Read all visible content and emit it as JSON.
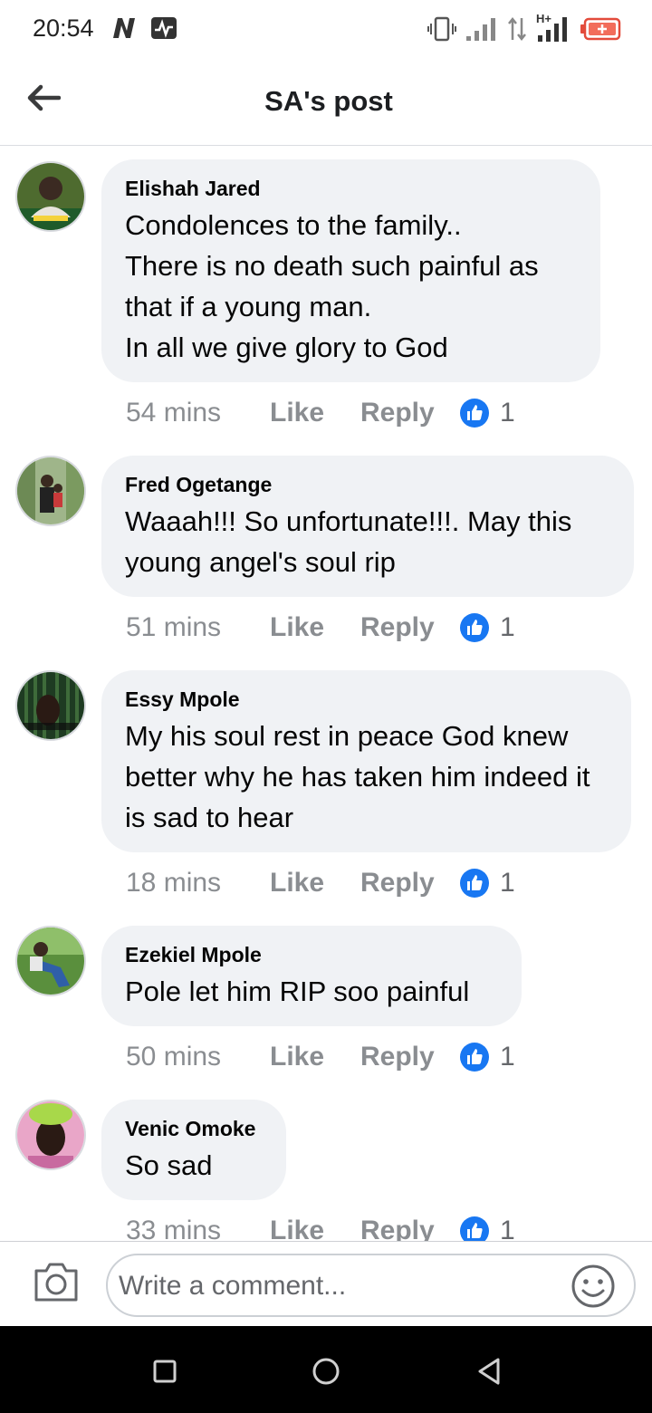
{
  "status_bar": {
    "time": "20:54",
    "icons": [
      "n-icon",
      "activity-icon",
      "vibrate-icon",
      "signal-icon",
      "data-arrows-icon",
      "hplus-signal-icon",
      "battery-icon"
    ],
    "network_label": "H+"
  },
  "header": {
    "title": "SA's post",
    "back_icon": "arrow-left-icon"
  },
  "comments": [
    {
      "author": "Elishah Jared",
      "text": "Condolences to the family..\nThere is no death such painful as that if a young man.\nIn all we give glory to God",
      "time": "54 mins",
      "like_label": "Like",
      "reply_label": "Reply",
      "reactions": "1"
    },
    {
      "author": "Fred Ogetange",
      "text": "Waaah!!! So unfortunate!!!. May this young angel's soul rip",
      "time": "51 mins",
      "like_label": "Like",
      "reply_label": "Reply",
      "reactions": "1"
    },
    {
      "author": "Essy Mpole",
      "text": "My his soul rest in peace God knew better why he has taken him indeed it is sad to hear",
      "time": "18 mins",
      "like_label": "Like",
      "reply_label": "Reply",
      "reactions": "1"
    },
    {
      "author": "Ezekiel Mpole",
      "text": "Pole let him RIP soo painful",
      "time": "50 mins",
      "like_label": "Like",
      "reply_label": "Reply",
      "reactions": "1"
    },
    {
      "author": "Venic Omoke",
      "text": "So sad",
      "time": "33 mins",
      "like_label": "Like",
      "reply_label": "Reply",
      "reactions": "1"
    }
  ],
  "composer": {
    "placeholder": "Write a comment...",
    "camera_icon": "camera-icon",
    "emoji_icon": "smiley-icon"
  },
  "navbar": {
    "icons": [
      "square-icon",
      "circle-icon",
      "triangle-back-icon"
    ]
  },
  "colors": {
    "like_blue": "#1877f2",
    "bubble_bg": "#f0f2f5",
    "meta_gray": "#8a8d91"
  }
}
